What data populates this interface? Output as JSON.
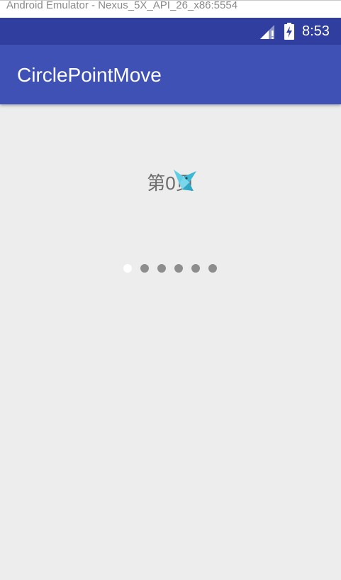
{
  "window": {
    "title": "Android Emulator - Nexus_5X_API_26_x86:5554"
  },
  "status_bar": {
    "time": "8:53",
    "icons": [
      "signal-icon",
      "battery-charging-icon"
    ]
  },
  "app_bar": {
    "title": "CirclePointMove"
  },
  "content": {
    "page_label_prefix": "第",
    "page_label_number": "0",
    "page_label_suffix": "页",
    "indicator": {
      "count": 6,
      "active_index": 0
    }
  },
  "colors": {
    "status_bar": "#303f9f",
    "app_bar": "#3f51b5",
    "background": "#ededed",
    "dot_inactive": "#8d8d8d",
    "dot_active": "#ffffff"
  }
}
